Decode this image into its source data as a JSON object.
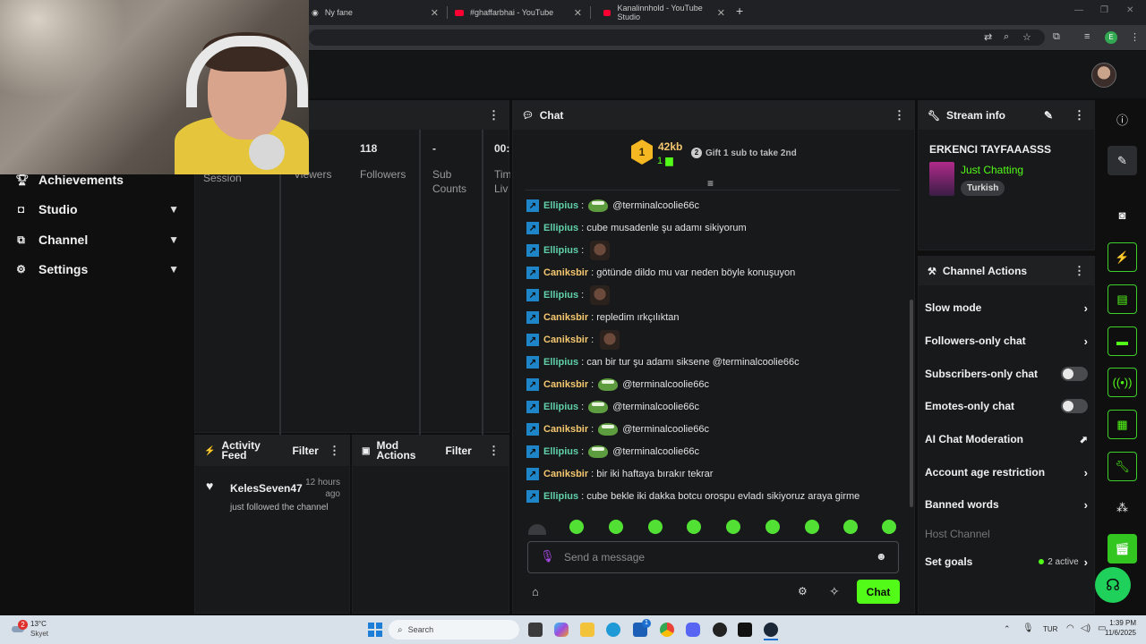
{
  "browser": {
    "tabs": [
      {
        "title": "Ny fane",
        "icon": "chrome-icon"
      },
      {
        "title": "#ghaffarbhai - YouTube",
        "icon": "youtube-icon"
      },
      {
        "title": "Kanalinnhold - YouTube Studio",
        "icon": "youtube-icon"
      }
    ],
    "profile_initial": "E",
    "new_tab": "+",
    "close": "✕"
  },
  "nav": {
    "items": [
      {
        "label": "Achievements",
        "icon": "trophy-icon",
        "expandable": false
      },
      {
        "label": "Studio",
        "icon": "studio-icon",
        "expandable": true
      },
      {
        "label": "Channel",
        "icon": "channel-icon",
        "expandable": true
      },
      {
        "label": "Settings",
        "icon": "gear-icon",
        "expandable": true
      }
    ]
  },
  "stats": {
    "session_label": "Session",
    "viewers_label": "Viewers",
    "followers_value": "118",
    "followers_label": "Followers",
    "subs_value": "-",
    "subs_label": "Sub Counts",
    "time_value": "00:",
    "time_label": "Tim Liv"
  },
  "activity": {
    "title": "Activity Feed",
    "filter": "Filter",
    "items": [
      {
        "user": "KelesSeven47",
        "time": "12 hours ago",
        "text": "just followed the channel"
      }
    ]
  },
  "mod_actions": {
    "title": "Mod Actions",
    "filter": "Filter"
  },
  "chat": {
    "title": "Chat",
    "leader": {
      "rank": "1",
      "name": "42kb",
      "count": "1"
    },
    "gift_rank": "2",
    "gift_text": "Gift 1 sub to take 2nd",
    "messages": [
      {
        "user": "Ellipius",
        "kind": "ell",
        "emote": "frog",
        "text": "@terminalcoolie66c"
      },
      {
        "user": "Ellipius",
        "kind": "ell",
        "emote": "",
        "text": "cube musadenle şu adamı sikiyorum"
      },
      {
        "user": "Ellipius",
        "kind": "ell",
        "emote": "face",
        "text": ""
      },
      {
        "user": "Caniksbir",
        "kind": "can",
        "emote": "",
        "text": "götünde dildo mu var neden böyle konuşuyon"
      },
      {
        "user": "Ellipius",
        "kind": "ell",
        "emote": "face",
        "text": ""
      },
      {
        "user": "Caniksbir",
        "kind": "can",
        "emote": "",
        "text": "repledim ırkçılıktan"
      },
      {
        "user": "Caniksbir",
        "kind": "can",
        "emote": "face",
        "text": ""
      },
      {
        "user": "Ellipius",
        "kind": "ell",
        "emote": "",
        "text": "can bir tur şu adamı siksene @terminalcoolie66c"
      },
      {
        "user": "Caniksbir",
        "kind": "can",
        "emote": "frog",
        "text": "@terminalcoolie66c"
      },
      {
        "user": "Ellipius",
        "kind": "ell",
        "emote": "frog",
        "text": "@terminalcoolie66c"
      },
      {
        "user": "Caniksbir",
        "kind": "can",
        "emote": "frog",
        "text": "@terminalcoolie66c"
      },
      {
        "user": "Ellipius",
        "kind": "ell",
        "emote": "frog",
        "text": "@terminalcoolie66c"
      },
      {
        "user": "Caniksbir",
        "kind": "can",
        "emote": "",
        "text": "bir iki haftaya bırakır tekrar"
      },
      {
        "user": "Ellipius",
        "kind": "ell",
        "emote": "",
        "text": "cube bekle iki dakka botcu orospu evladı sikiyoruz araya girme"
      }
    ],
    "input_placeholder": "Send a message",
    "send_label": "Chat"
  },
  "stream_info": {
    "title": "Stream info",
    "stream_title": "ERKENCI TAYFAAASSS",
    "category": "Just Chatting",
    "tag": "Turkish"
  },
  "channel_actions": {
    "title": "Channel Actions",
    "items": [
      {
        "label": "Slow mode",
        "control": "chevron"
      },
      {
        "label": "Followers-only chat",
        "control": "chevron"
      },
      {
        "label": "Subscribers-only chat",
        "control": "toggle"
      },
      {
        "label": "Emotes-only chat",
        "control": "toggle"
      },
      {
        "label": "AI Chat Moderation",
        "control": "external"
      },
      {
        "label": "Account age restriction",
        "control": "chevron"
      },
      {
        "label": "Banned words",
        "control": "chevron"
      }
    ],
    "host_channel": "Host Channel",
    "set_goals": "Set goals",
    "goals_active": "2 active"
  },
  "taskbar": {
    "weather_temp": "13°C",
    "weather_desc": "Skyet",
    "notif_count": "2",
    "search": "Search",
    "app_badge": "1",
    "lang": "TUR",
    "time": "1:39 PM",
    "date": "11/6/2025"
  },
  "colors": {
    "kick_green": "#53fc18",
    "ellipius": "#60d0a8",
    "caniksbir": "#f5c870"
  }
}
